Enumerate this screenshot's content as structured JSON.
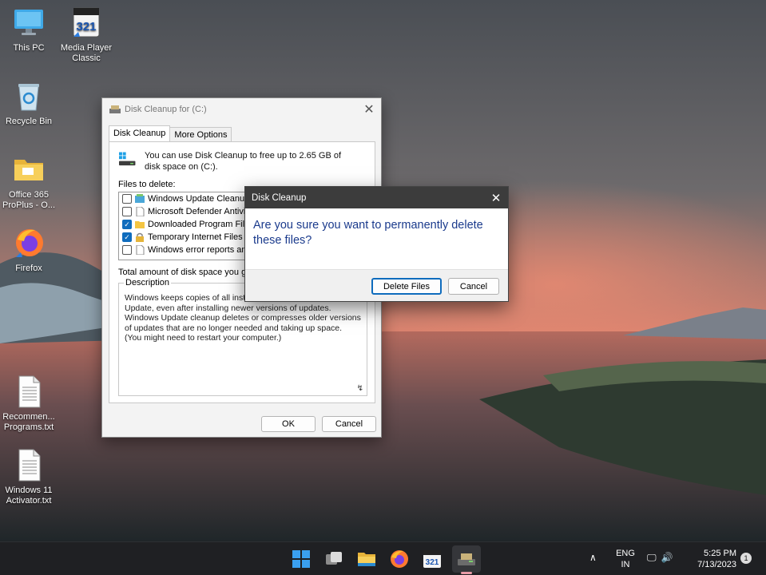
{
  "desktop": {
    "icons": [
      {
        "label": "This PC",
        "icon": "monitor-icon"
      },
      {
        "label": "Media Player Classic",
        "icon": "media-player-icon"
      },
      {
        "label": "Recycle Bin",
        "icon": "recycle-bin-icon"
      },
      {
        "label": "Office 365 ProPlus - O...",
        "icon": "folder-icon"
      },
      {
        "label": "Firefox",
        "icon": "firefox-icon"
      },
      {
        "label": "Recommen... Programs.txt",
        "icon": "text-file-icon"
      },
      {
        "label": "Windows 11 Activator.txt",
        "icon": "text-file-icon"
      }
    ]
  },
  "cleanup_window": {
    "title": "Disk Cleanup for  (C:)",
    "tabs": [
      "Disk Cleanup",
      "More Options"
    ],
    "intro": "You can use Disk Cleanup to free up to 2.65 GB of disk space on  (C:).",
    "files_label": "Files to delete:",
    "files": [
      {
        "name": "Windows Update Cleanup",
        "checked": false
      },
      {
        "name": "Microsoft Defender Antivirus",
        "checked": false
      },
      {
        "name": "Downloaded Program Files",
        "checked": true
      },
      {
        "name": "Temporary Internet Files",
        "checked": true
      },
      {
        "name": "Windows error reports and f",
        "checked": false
      }
    ],
    "total_label": "Total amount of disk space you gain",
    "description_label": "Description",
    "description": "Windows keeps copies of all installed updates from Windows Update, even after installing newer versions of updates. Windows Update cleanup deletes or compresses older versions of updates that are no longer needed and taking up space. (You might need to restart your computer.)",
    "ok_label": "OK",
    "cancel_label": "Cancel"
  },
  "confirm_dialog": {
    "title": "Disk Cleanup",
    "message": "Are you sure you want to permanently delete these files?",
    "delete_label": "Delete Files",
    "cancel_label": "Cancel"
  },
  "taskbar": {
    "apps": [
      "start-icon",
      "task-view-icon",
      "file-explorer-icon",
      "firefox-icon",
      "media-player-icon",
      "disk-cleanup-icon"
    ],
    "lang_line1": "ENG",
    "lang_line2": "IN",
    "time": "5:25 PM",
    "date": "7/13/2023",
    "notification_count": "1"
  },
  "colors": {
    "accent": "#0f6cbd",
    "dialog_title_bg": "#3c3c3c",
    "dialog_message": "#1a3a8c",
    "taskbar_bg": "#1f2023"
  }
}
